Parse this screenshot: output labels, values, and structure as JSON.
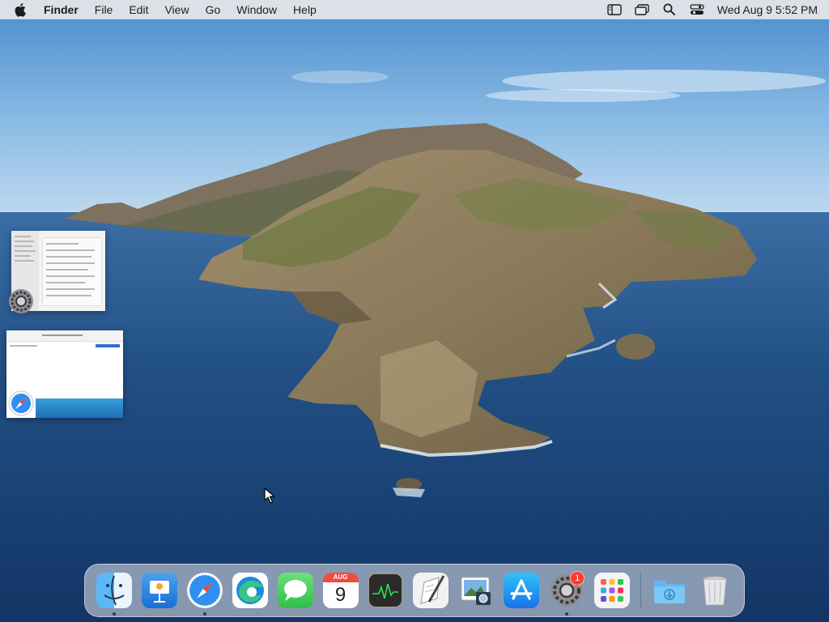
{
  "menubar": {
    "app_name": "Finder",
    "items": [
      "File",
      "Edit",
      "View",
      "Go",
      "Window",
      "Help"
    ],
    "clock": "Wed Aug 9  5:52 PM",
    "status_icons": [
      "sidebar-icon",
      "screen-mirroring-icon",
      "spotlight-search-icon",
      "control-center-icon"
    ]
  },
  "dock": {
    "apps": [
      {
        "name": "Finder",
        "icon": "finder-icon",
        "running": true
      },
      {
        "name": "Keynote",
        "icon": "keynote-icon",
        "running": false
      },
      {
        "name": "Safari",
        "icon": "safari-icon",
        "running": true
      },
      {
        "name": "Microsoft Edge",
        "icon": "edge-icon",
        "running": false
      },
      {
        "name": "Messages",
        "icon": "messages-icon",
        "running": false
      },
      {
        "name": "Calendar",
        "icon": "calendar-icon",
        "running": false,
        "month": "AUG",
        "day": "9"
      },
      {
        "name": "Activity Monitor",
        "icon": "activity-monitor-icon",
        "running": false
      },
      {
        "name": "Script Editor",
        "icon": "script-editor-icon",
        "running": false
      },
      {
        "name": "Preview",
        "icon": "preview-icon",
        "running": false
      },
      {
        "name": "App Store",
        "icon": "app-store-icon",
        "running": false
      },
      {
        "name": "System Settings",
        "icon": "system-settings-icon",
        "running": true,
        "badge": "1"
      },
      {
        "name": "Launchpad",
        "icon": "launchpad-icon",
        "running": false
      },
      {
        "name": "Downloads",
        "icon": "downloads-folder-icon",
        "running": false
      },
      {
        "name": "Trash",
        "icon": "trash-icon",
        "running": false
      }
    ]
  },
  "stage_manager": {
    "windows": [
      {
        "app": "System Settings",
        "icon": "system-settings-icon"
      },
      {
        "app": "Safari",
        "icon": "safari-icon"
      }
    ]
  },
  "colors": {
    "menubar_bg": "#e8e8ea",
    "badge": "#ff3b30",
    "sea": "#1f4f82",
    "sky": "#7fb0dc"
  }
}
